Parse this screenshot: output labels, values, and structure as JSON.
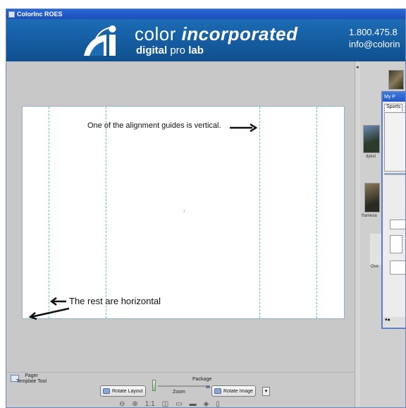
{
  "window": {
    "title": "ColorInc ROES"
  },
  "banner": {
    "brand_light": "color ",
    "brand_bold": "incorporated",
    "sub_bold1": "digital",
    "sub_light": " pro ",
    "sub_bold2": "lab",
    "phone": "1.800.475.8",
    "email": "info@colorin"
  },
  "canvas": {
    "page_number": "1",
    "annotation_vertical": "One of the alignment guides is vertical.",
    "annotation_horizontal": "The rest are horizontal"
  },
  "right_panel": {
    "subwindow_title": "My P",
    "tab_label": "Sports",
    "thumb_labels": [
      "dykst",
      "framesa",
      "Ove"
    ]
  },
  "bottom": {
    "pager_label_line1": "Pager",
    "pager_label_line2": "Template Tool",
    "package_label": "Package",
    "rotate_layout": "Rotate Layout",
    "zoom_label": "Zoom",
    "rotate_image": "Rotate Image",
    "dropdown_glyph": "▾",
    "toolrow_icons": [
      "⊖",
      "⊕",
      "1:1",
      "◫",
      "▭",
      "▬",
      "◈",
      "▯"
    ]
  },
  "colors": {
    "banner_blue": "#0f4f8e",
    "guide_cyan": "#5fc4d2",
    "titlebar_blue": "#2a67d8"
  }
}
